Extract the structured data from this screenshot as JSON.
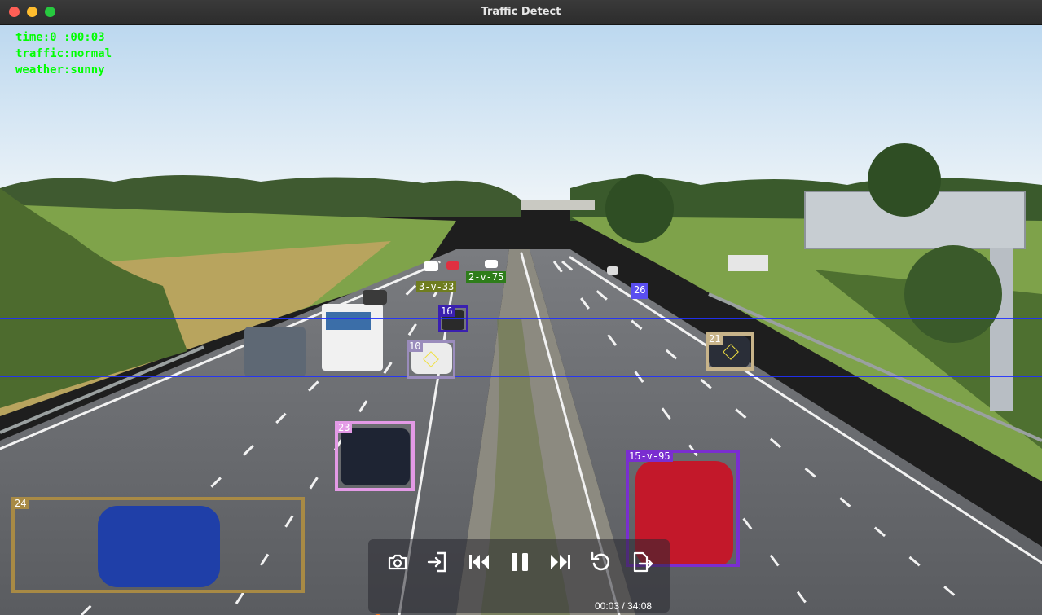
{
  "window": {
    "title": "Traffic Detect"
  },
  "overlay": {
    "lines": [
      "time:0 :00:03",
      "traffic:normal",
      "weather:sunny"
    ]
  },
  "detections": [
    {
      "label": "3-v-33",
      "color": "#6f7d1f"
    },
    {
      "label": "2-v-75",
      "color": "#2e7d1a"
    },
    {
      "label": "26",
      "color": "#5a4ef0"
    },
    {
      "label": "16",
      "color": "#3a1fb0"
    },
    {
      "label": "10",
      "color": "#9a8cbc"
    },
    {
      "label": "21",
      "color": "#c8b48a"
    },
    {
      "label": "23",
      "color": "#e39ae6"
    },
    {
      "label": "15-v-95",
      "color": "#7a2ed0"
    },
    {
      "label": "24",
      "color": "#a88a45"
    }
  ],
  "player": {
    "time_display": "00:03 / 34:08",
    "progress_fraction": 0.0,
    "buttons": [
      "screenshot",
      "open-file",
      "previous",
      "pause",
      "next",
      "replay",
      "export"
    ],
    "accent": "#ff7a1a"
  }
}
